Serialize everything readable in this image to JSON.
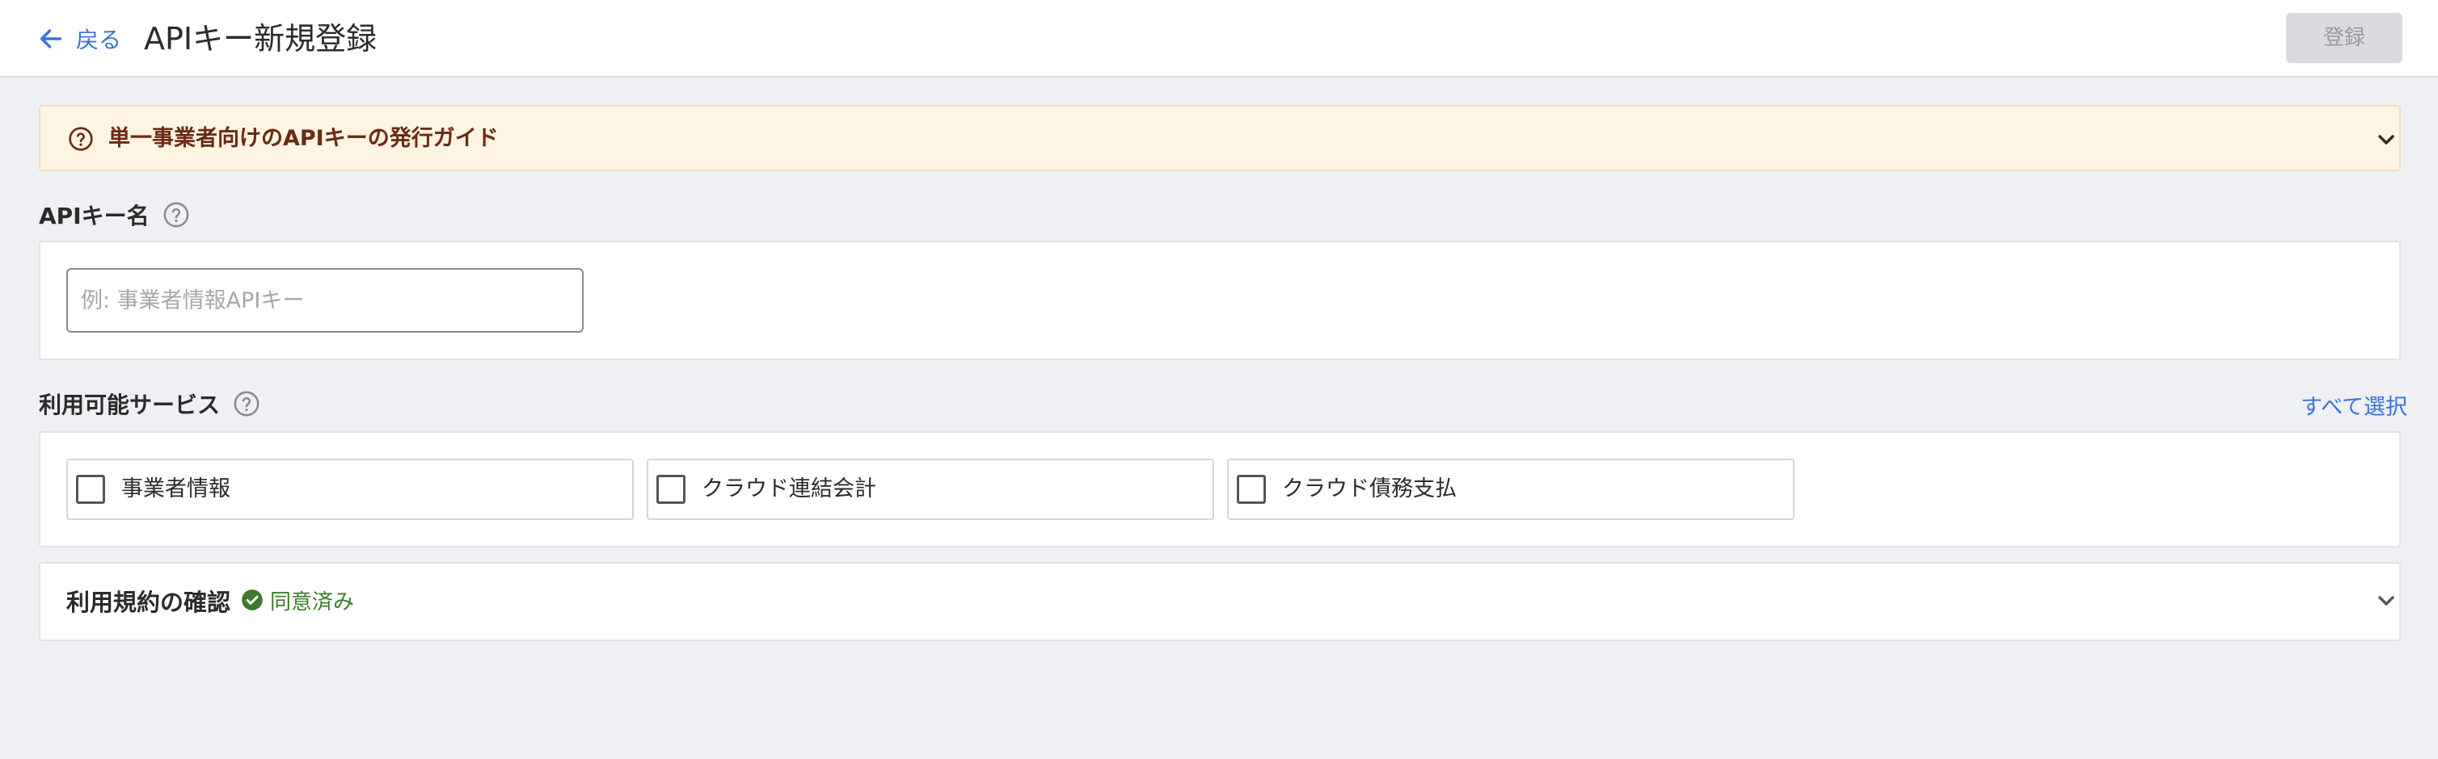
{
  "header": {
    "back_label": "戻る",
    "title": "APIキー新規登録",
    "register_label": "登録",
    "register_enabled": false
  },
  "guide": {
    "text": "単一事業者向けのAPIキーの発行ガイド",
    "expanded": false
  },
  "api_key_name": {
    "label": "APIキー名",
    "value": "",
    "placeholder": "例: 事業者情報APIキー"
  },
  "services": {
    "label": "利用可能サービス",
    "select_all_label": "すべて選択",
    "items": [
      {
        "label": "事業者情報",
        "checked": false
      },
      {
        "label": "クラウド連結会計",
        "checked": false
      },
      {
        "label": "クラウド債務支払",
        "checked": false
      }
    ]
  },
  "terms": {
    "title": "利用規約の確認",
    "status": "同意済み",
    "expanded": false
  },
  "colors": {
    "accent": "#3b72d9",
    "guide_bg": "#fdf4e1",
    "guide_text": "#6b2b14",
    "success": "#3c7a2c",
    "page_bg": "#eff0f4"
  },
  "icons": {
    "back": "arrow-left-icon",
    "guide": "question-circle-icon",
    "help": "question-circle-icon",
    "expand": "chevron-down-icon",
    "agreed": "check-circle-icon"
  }
}
